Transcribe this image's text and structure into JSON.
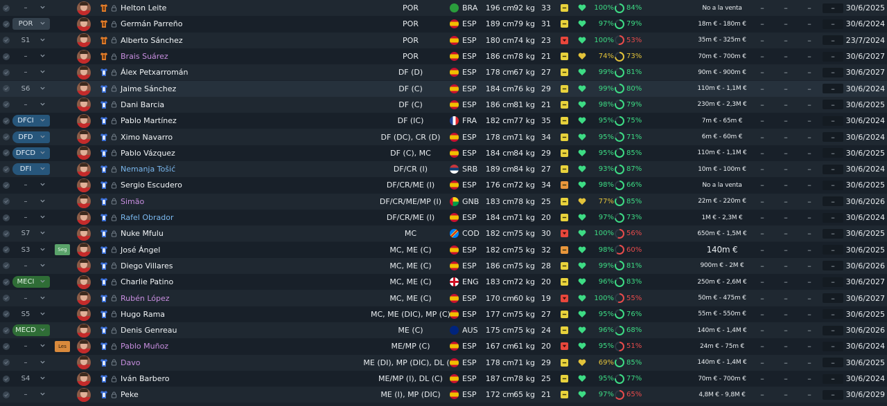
{
  "colors": {
    "fit_green": "#3ddc84",
    "fit_yellow": "#e3c33a",
    "ring_green": "#3ddc84",
    "ring_red": "#e94b4b",
    "ring_yellow": "#e3c33a",
    "loan_name": "#c88ee0",
    "new_name": "#7ab8ef"
  },
  "players": [
    {
      "pos": "–",
      "pos_style": "plain",
      "tag": "",
      "name": "Helton Leite",
      "name_style": "",
      "position": "POR",
      "nat": "BRA",
      "flag": "bra",
      "height": "196 cm",
      "weight": "92 kg",
      "age": "33",
      "cond": "yellow",
      "heart": "green",
      "fit": "100%",
      "fit_color": "green",
      "ring": "84%",
      "ring_color": "green",
      "ring_level": 0.84,
      "value": "No a la venta",
      "value_big": false,
      "contract": "30/6/2025",
      "kit": "gk"
    },
    {
      "pos": "POR",
      "pos_style": "gk",
      "tag": "",
      "name": "Germán Parreño",
      "name_style": "",
      "position": "POR",
      "nat": "ESP",
      "flag": "esp",
      "height": "189 cm",
      "weight": "79 kg",
      "age": "31",
      "cond": "yellow",
      "heart": "green",
      "fit": "97%",
      "fit_color": "green",
      "ring": "79%",
      "ring_color": "green",
      "ring_level": 0.79,
      "value": "18m € - 180m €",
      "value_big": false,
      "contract": "30/6/2024",
      "kit": "gk"
    },
    {
      "pos": "S1",
      "pos_style": "plain",
      "tag": "",
      "name": "Alberto Sánchez",
      "name_style": "",
      "position": "POR",
      "nat": "ESP",
      "flag": "esp",
      "height": "180 cm",
      "weight": "74 kg",
      "age": "23",
      "cond": "red",
      "heart": "green",
      "fit": "100%",
      "fit_color": "green",
      "ring": "53%",
      "ring_color": "red",
      "ring_level": 0.53,
      "value": "35m € - 325m €",
      "value_big": false,
      "contract": "23/7/2024",
      "kit": "gk"
    },
    {
      "pos": "–",
      "pos_style": "plain",
      "tag": "",
      "name": "Brais Suárez",
      "name_style": "loan",
      "position": "POR",
      "nat": "ESP",
      "flag": "esp",
      "height": "186 cm",
      "weight": "78 kg",
      "age": "21",
      "cond": "yellow",
      "heart": "yellow",
      "fit": "74%",
      "fit_color": "yellow",
      "ring": "73%",
      "ring_color": "yellow",
      "ring_level": 0.73,
      "value": "70m € - 700m €",
      "value_big": false,
      "contract": "30/6/2027",
      "kit": "gk"
    },
    {
      "pos": "–",
      "pos_style": "plain",
      "tag": "",
      "name": "Álex Petxarromán",
      "name_style": "",
      "position": "DF (D)",
      "nat": "ESP",
      "flag": "esp",
      "height": "178 cm",
      "weight": "67 kg",
      "age": "27",
      "cond": "yellow",
      "heart": "green",
      "fit": "99%",
      "fit_color": "green",
      "ring": "81%",
      "ring_color": "green",
      "ring_level": 0.81,
      "value": "90m € - 900m €",
      "value_big": false,
      "contract": "30/6/2027",
      "kit": "out"
    },
    {
      "pos": "S6",
      "pos_style": "plain",
      "tag": "",
      "name": "Jaime Sánchez",
      "name_style": "",
      "position": "DF (C)",
      "nat": "ESP",
      "flag": "esp",
      "height": "184 cm",
      "weight": "76 kg",
      "age": "29",
      "cond": "yellow",
      "heart": "green",
      "fit": "99%",
      "fit_color": "green",
      "ring": "80%",
      "ring_color": "green",
      "ring_level": 0.8,
      "value": "110m € - 1,1M €",
      "value_big": false,
      "contract": "30/6/2024",
      "kit": "out",
      "highlight": true
    },
    {
      "pos": "–",
      "pos_style": "plain",
      "tag": "",
      "name": "Dani Barcia",
      "name_style": "",
      "position": "DF (C)",
      "nat": "ESP",
      "flag": "esp",
      "height": "186 cm",
      "weight": "81 kg",
      "age": "21",
      "cond": "yellow",
      "heart": "green",
      "fit": "98%",
      "fit_color": "green",
      "ring": "79%",
      "ring_color": "green",
      "ring_level": 0.79,
      "value": "230m € - 2,3M €",
      "value_big": false,
      "contract": "30/6/2025",
      "kit": "out"
    },
    {
      "pos": "DFCI",
      "pos_style": "def",
      "tag": "",
      "name": "Pablo Martínez",
      "name_style": "",
      "position": "DF (IC)",
      "nat": "FRA",
      "flag": "fra",
      "height": "182 cm",
      "weight": "77 kg",
      "age": "35",
      "cond": "yellow",
      "heart": "green",
      "fit": "95%",
      "fit_color": "green",
      "ring": "75%",
      "ring_color": "green",
      "ring_level": 0.75,
      "value": "7m € - 65m €",
      "value_big": false,
      "contract": "30/6/2024",
      "kit": "out"
    },
    {
      "pos": "DFD",
      "pos_style": "def",
      "tag": "",
      "name": "Ximo Navarro",
      "name_style": "",
      "position": "DF (DC), CR (D)",
      "nat": "ESP",
      "flag": "esp",
      "height": "178 cm",
      "weight": "71 kg",
      "age": "34",
      "cond": "yellow",
      "heart": "green",
      "fit": "95%",
      "fit_color": "green",
      "ring": "71%",
      "ring_color": "green",
      "ring_level": 0.71,
      "value": "6m € - 60m €",
      "value_big": false,
      "contract": "30/6/2024",
      "kit": "out"
    },
    {
      "pos": "DFCD",
      "pos_style": "def",
      "tag": "",
      "name": "Pablo Vázquez",
      "name_style": "",
      "position": "DF (C), MC",
      "nat": "ESP",
      "flag": "esp",
      "height": "184 cm",
      "weight": "84 kg",
      "age": "29",
      "cond": "yellow",
      "heart": "green",
      "fit": "95%",
      "fit_color": "green",
      "ring": "85%",
      "ring_color": "green",
      "ring_level": 0.85,
      "value": "110m € - 1,1M €",
      "value_big": false,
      "contract": "30/6/2025",
      "kit": "out"
    },
    {
      "pos": "DFI",
      "pos_style": "def",
      "tag": "",
      "name": "Nemanja Tošić",
      "name_style": "new",
      "position": "DF/CR (I)",
      "nat": "SRB",
      "flag": "srb",
      "height": "189 cm",
      "weight": "84 kg",
      "age": "27",
      "cond": "yellow",
      "heart": "green",
      "fit": "93%",
      "fit_color": "green",
      "ring": "87%",
      "ring_color": "green",
      "ring_level": 0.87,
      "value": "10m € - 100m €",
      "value_big": false,
      "contract": "30/6/2024",
      "kit": "out"
    },
    {
      "pos": "–",
      "pos_style": "plain",
      "tag": "",
      "name": "Sergio Escudero",
      "name_style": "",
      "position": "DF/CR/ME (I)",
      "nat": "ESP",
      "flag": "esp",
      "height": "176 cm",
      "weight": "72 kg",
      "age": "34",
      "cond": "orange",
      "heart": "green",
      "fit": "98%",
      "fit_color": "green",
      "ring": "66%",
      "ring_color": "green",
      "ring_level": 0.66,
      "value": "No a la venta",
      "value_big": false,
      "contract": "30/6/2025",
      "kit": "out"
    },
    {
      "pos": "–",
      "pos_style": "plain",
      "tag": "",
      "name": "Simão",
      "name_style": "loan",
      "position": "DF/CR/ME/MP (I)",
      "nat": "GNB",
      "flag": "gnb",
      "height": "183 cm",
      "weight": "78 kg",
      "age": "25",
      "cond": "yellow",
      "heart": "yellow",
      "fit": "77%",
      "fit_color": "yellow",
      "ring": "85%",
      "ring_color": "green",
      "ring_level": 0.85,
      "value": "22m € - 220m €",
      "value_big": false,
      "contract": "30/6/2026",
      "kit": "out"
    },
    {
      "pos": "–",
      "pos_style": "plain",
      "tag": "",
      "name": "Rafel Obrador",
      "name_style": "new",
      "position": "DF/CR/ME (I)",
      "nat": "ESP",
      "flag": "esp",
      "height": "184 cm",
      "weight": "71 kg",
      "age": "20",
      "cond": "yellow",
      "heart": "green",
      "fit": "97%",
      "fit_color": "green",
      "ring": "73%",
      "ring_color": "green",
      "ring_level": 0.73,
      "value": "1M € - 2,3M €",
      "value_big": false,
      "contract": "30/6/2024",
      "kit": "out"
    },
    {
      "pos": "S7",
      "pos_style": "plain",
      "tag": "",
      "name": "Nuke Mfulu",
      "name_style": "",
      "position": "MC",
      "nat": "COD",
      "flag": "cod",
      "height": "182 cm",
      "weight": "75 kg",
      "age": "30",
      "cond": "red",
      "heart": "green",
      "fit": "100%",
      "fit_color": "green",
      "ring": "56%",
      "ring_color": "red",
      "ring_level": 0.56,
      "value": "650m € - 1,5M €",
      "value_big": false,
      "contract": "30/6/2025",
      "kit": "out"
    },
    {
      "pos": "S3",
      "pos_style": "plain",
      "tag": "Seg",
      "tag_style": "green",
      "name": "José Ángel",
      "name_style": "",
      "position": "MC, ME (C)",
      "nat": "ESP",
      "flag": "esp",
      "height": "182 cm",
      "weight": "75 kg",
      "age": "32",
      "cond": "orange",
      "heart": "green",
      "fit": "98%",
      "fit_color": "green",
      "ring": "60%",
      "ring_color": "red",
      "ring_level": 0.6,
      "value": "140m €",
      "value_big": true,
      "contract": "30/6/2025",
      "kit": "out"
    },
    {
      "pos": "–",
      "pos_style": "plain",
      "tag": "",
      "name": "Diego Villares",
      "name_style": "",
      "position": "MC, ME (C)",
      "nat": "ESP",
      "flag": "esp",
      "height": "186 cm",
      "weight": "75 kg",
      "age": "28",
      "cond": "yellow",
      "heart": "green",
      "fit": "99%",
      "fit_color": "green",
      "ring": "81%",
      "ring_color": "green",
      "ring_level": 0.81,
      "value": "900m € - 2M €",
      "value_big": false,
      "contract": "30/6/2026",
      "kit": "out"
    },
    {
      "pos": "MECI",
      "pos_style": "mid",
      "tag": "",
      "name": "Charlie Patino",
      "name_style": "",
      "position": "MC, ME (C)",
      "nat": "ENG",
      "flag": "eng",
      "height": "183 cm",
      "weight": "72 kg",
      "age": "20",
      "cond": "yellow",
      "heart": "green",
      "fit": "96%",
      "fit_color": "green",
      "ring": "83%",
      "ring_color": "green",
      "ring_level": 0.83,
      "value": "250m € - 2,6M €",
      "value_big": false,
      "contract": "30/6/2027",
      "kit": "out"
    },
    {
      "pos": "–",
      "pos_style": "plain",
      "tag": "",
      "name": "Rubén López",
      "name_style": "loan",
      "position": "MC, ME (C)",
      "nat": "ESP",
      "flag": "esp",
      "height": "170 cm",
      "weight": "60 kg",
      "age": "19",
      "cond": "red",
      "heart": "green",
      "fit": "100%",
      "fit_color": "green",
      "ring": "55%",
      "ring_color": "red",
      "ring_level": 0.55,
      "value": "50m € - 475m €",
      "value_big": false,
      "contract": "30/6/2027",
      "kit": "out"
    },
    {
      "pos": "S5",
      "pos_style": "plain",
      "tag": "",
      "name": "Hugo Rama",
      "name_style": "",
      "position": "MC, ME (DIC), MP (C)",
      "nat": "ESP",
      "flag": "esp",
      "height": "177 cm",
      "weight": "75 kg",
      "age": "27",
      "cond": "yellow",
      "heart": "green",
      "fit": "95%",
      "fit_color": "green",
      "ring": "76%",
      "ring_color": "green",
      "ring_level": 0.76,
      "value": "55m € - 550m €",
      "value_big": false,
      "contract": "30/6/2025",
      "kit": "out"
    },
    {
      "pos": "MECD",
      "pos_style": "mid",
      "tag": "",
      "name": "Denis Genreau",
      "name_style": "",
      "position": "ME (C)",
      "nat": "AUS",
      "flag": "aus",
      "height": "175 cm",
      "weight": "75 kg",
      "age": "24",
      "cond": "yellow",
      "heart": "green",
      "fit": "96%",
      "fit_color": "green",
      "ring": "68%",
      "ring_color": "green",
      "ring_level": 0.68,
      "value": "140m € - 1,4M €",
      "value_big": false,
      "contract": "30/6/2026",
      "kit": "out"
    },
    {
      "pos": "–",
      "pos_style": "plain",
      "tag": "Les",
      "tag_style": "orange",
      "name": "Pablo Muñoz",
      "name_style": "loan",
      "position": "ME/MP (C)",
      "nat": "ESP",
      "flag": "esp",
      "height": "167 cm",
      "weight": "61 kg",
      "age": "20",
      "cond": "red",
      "heart": "green",
      "fit": "95%",
      "fit_color": "green",
      "ring": "51%",
      "ring_color": "red",
      "ring_level": 0.51,
      "value": "24m € - 75m €",
      "value_big": false,
      "contract": "30/6/2024",
      "kit": "out"
    },
    {
      "pos": "–",
      "pos_style": "plain",
      "tag": "",
      "name": "Davo",
      "name_style": "loan",
      "position": "ME (DI), MP (DIC), DL (C)",
      "nat": "ESP",
      "flag": "esp",
      "height": "178 cm",
      "weight": "71 kg",
      "age": "29",
      "cond": "yellow",
      "heart": "yellow",
      "fit": "69%",
      "fit_color": "yellow",
      "ring": "85%",
      "ring_color": "green",
      "ring_level": 0.85,
      "value": "140m € - 1,4M €",
      "value_big": false,
      "contract": "30/6/2025",
      "kit": "out"
    },
    {
      "pos": "S4",
      "pos_style": "plain",
      "tag": "",
      "name": "Iván Barbero",
      "name_style": "",
      "position": "ME/MP (I), DL (C)",
      "nat": "ESP",
      "flag": "esp",
      "height": "187 cm",
      "weight": "78 kg",
      "age": "25",
      "cond": "yellow",
      "heart": "green",
      "fit": "95%",
      "fit_color": "green",
      "ring": "77%",
      "ring_color": "green",
      "ring_level": 0.77,
      "value": "70m € - 700m €",
      "value_big": false,
      "contract": "30/6/2024",
      "kit": "out"
    },
    {
      "pos": "–",
      "pos_style": "plain",
      "tag": "",
      "name": "Peke",
      "name_style": "",
      "position": "ME (I), MP (DIC)",
      "nat": "ESP",
      "flag": "esp",
      "height": "172 cm",
      "weight": "65 kg",
      "age": "21",
      "cond": "yellow",
      "heart": "green",
      "fit": "97%",
      "fit_color": "green",
      "ring": "65%",
      "ring_color": "red",
      "ring_level": 0.65,
      "value": "4,8M € - 9,8M €",
      "value_big": false,
      "contract": "30/6/2029",
      "kit": "out"
    }
  ],
  "dash": "–"
}
